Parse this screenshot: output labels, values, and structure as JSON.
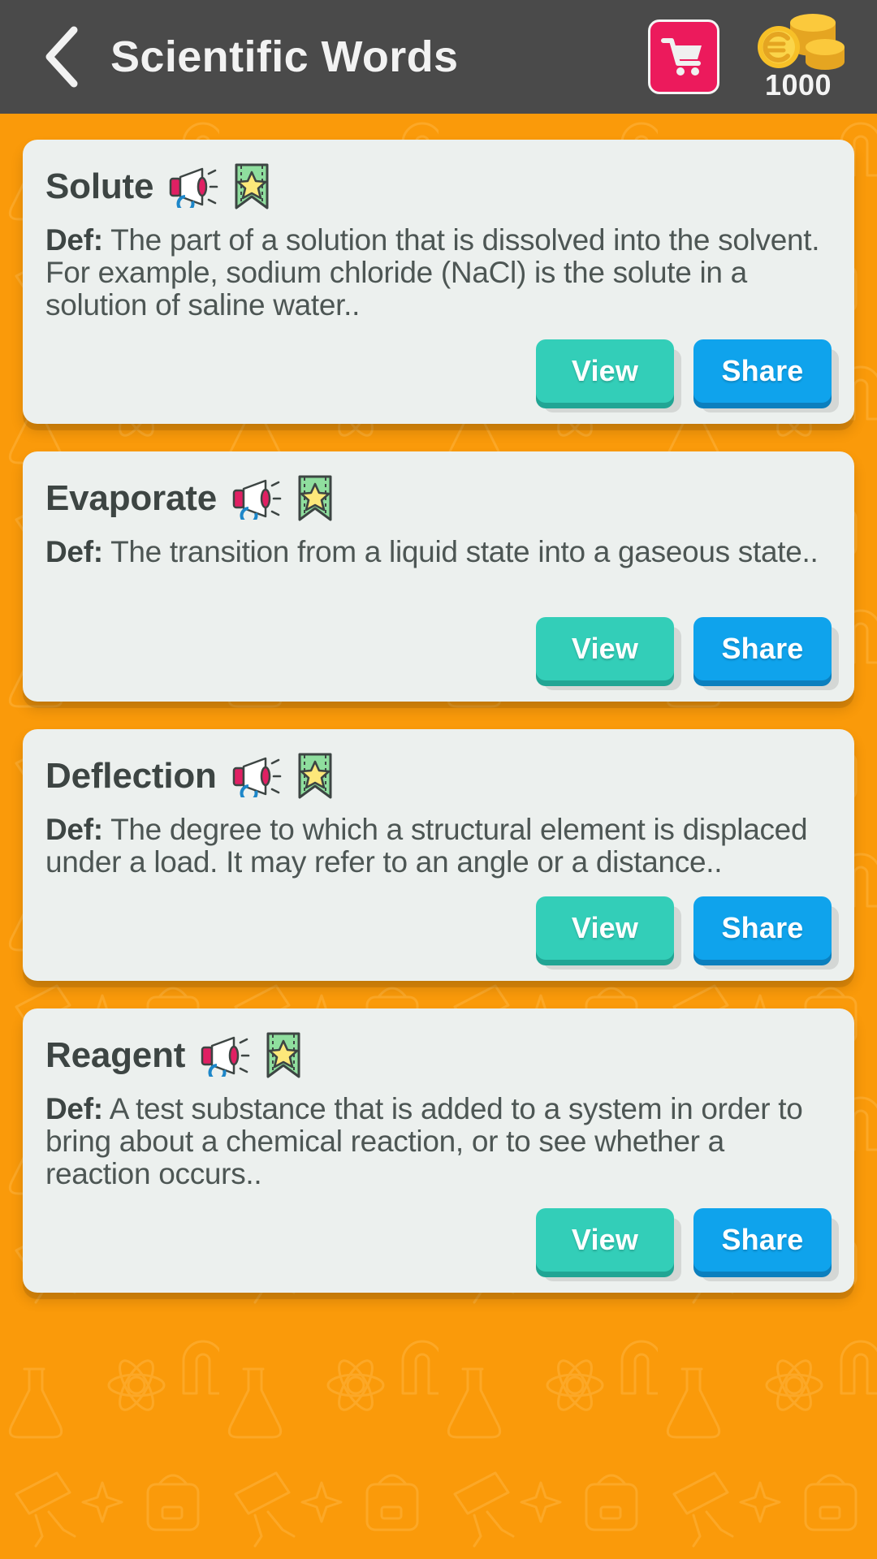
{
  "header": {
    "back_icon": "chevron-left-icon",
    "title": "Scientific Words",
    "shop_icon": "shopping-cart-icon",
    "coin_icon": "euro-coins-icon",
    "coin_count": "1000"
  },
  "theme": {
    "background": "#FA9A0A",
    "header_background": "#4A4A4A",
    "card_background": "#ECF0EE",
    "title_text": "#3D4543",
    "body_text": "#4D5654",
    "view_button": "#33CEB8",
    "view_button_shadow": "#21A594",
    "share_button": "#0FA3EC",
    "share_button_shadow": "#0B7FBE",
    "shop_button": "#EC1A5C",
    "bookmark_green": "#8FDE9E",
    "star_yellow": "#FDE87A"
  },
  "labels": {
    "def_prefix": "Def:",
    "view": "View",
    "share": "Share",
    "speak_icon": "megaphone-icon",
    "bookmark_icon": "bookmark-star-icon"
  },
  "cards": [
    {
      "word": "Solute",
      "definition": "The part of a solution that is dissolved into the solvent. For example, sodium chloride (NaCl) is the solute in a solution of saline water.."
    },
    {
      "word": "Evaporate",
      "definition": "The transition from a liquid state into a gaseous state.."
    },
    {
      "word": "Deflection",
      "definition": "The degree to which a structural element is displaced under a load. It may refer to an angle or a distance.."
    },
    {
      "word": "Reagent",
      "definition": "A test substance that is added to a system in order to bring about a chemical reaction, or to see whether a reaction occurs.."
    }
  ]
}
